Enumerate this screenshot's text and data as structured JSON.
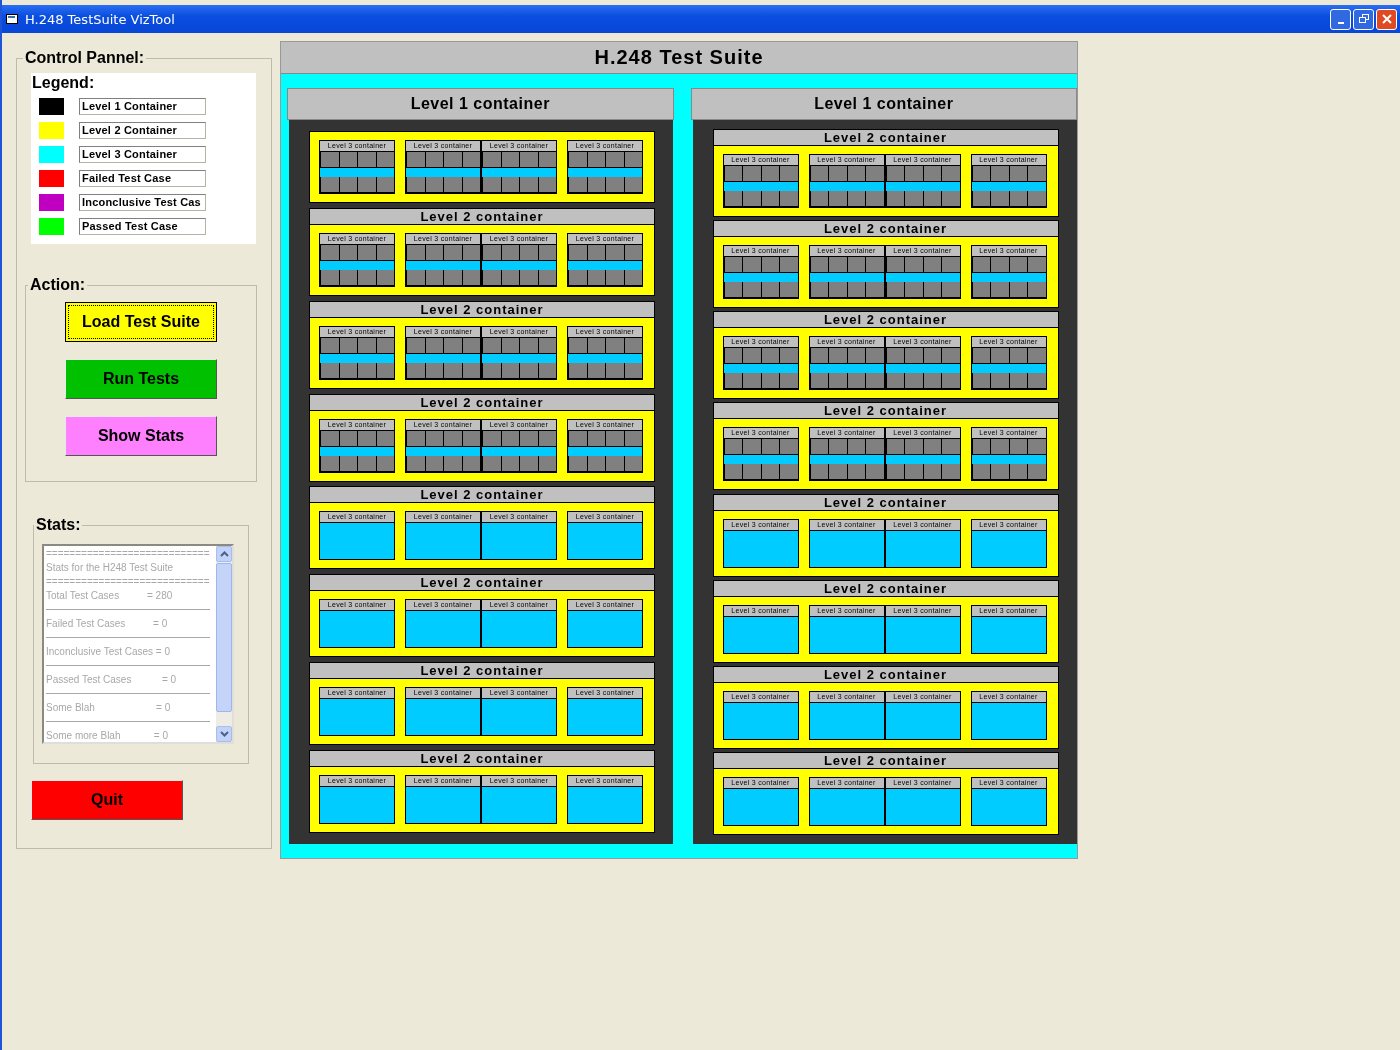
{
  "window": {
    "title": "H.248 TestSuite VizTool"
  },
  "control_panel": {
    "title": "Control Pannel:",
    "legend": {
      "title": "Legend:",
      "items": [
        {
          "label": "Level 1 Container",
          "color": "#000000"
        },
        {
          "label": "Level 2 Container",
          "color": "#ffff00"
        },
        {
          "label": "Level 3 Container",
          "color": "#00ffff"
        },
        {
          "label": "Failed Test Case",
          "color": "#ff0000"
        },
        {
          "label": "Inconclusive Test Cas",
          "color": "#c000c0"
        },
        {
          "label": "Passed Test Case",
          "color": "#00ff00"
        }
      ]
    },
    "action": {
      "title": "Action:",
      "buttons": [
        {
          "label": "Load Test Suite",
          "color": "#ffff00",
          "focused": true
        },
        {
          "label": "Run Tests",
          "color": "#00c000",
          "focused": false
        },
        {
          "label": "Show Stats",
          "color": "#ff80ff",
          "focused": false
        }
      ]
    },
    "stats": {
      "title": "Stats:",
      "lines": [
        {
          "kind": "text",
          "text": "============================"
        },
        {
          "kind": "text",
          "text": "Stats for the H248 Test Suite"
        },
        {
          "kind": "text",
          "text": "============================"
        },
        {
          "kind": "text",
          "text": "Total Test Cases          = 280"
        },
        {
          "kind": "rule"
        },
        {
          "kind": "text",
          "text": "Failed Test Cases          = 0"
        },
        {
          "kind": "rule"
        },
        {
          "kind": "text",
          "text": "Inconclusive Test Cases = 0"
        },
        {
          "kind": "rule"
        },
        {
          "kind": "text",
          "text": "Passed Test Cases           = 0"
        },
        {
          "kind": "rule"
        },
        {
          "kind": "text",
          "text": "Some Blah                      = 0"
        },
        {
          "kind": "rule"
        },
        {
          "kind": "text",
          "text": "Some more Blah            = 0"
        }
      ]
    },
    "quit": {
      "label": "Quit",
      "color": "#ff0000"
    }
  },
  "suite": {
    "title": "H.248 Test Suite",
    "level1": [
      {
        "title": "Level 1 container",
        "level2": [
          {
            "level3": [
              {
                "label": "Level 3 container",
                "kind": "grid"
              },
              {
                "label": "Level 3 container",
                "kind": "grid"
              },
              {
                "label": "Level 3 container",
                "kind": "grid"
              },
              {
                "label": "Level 3 container",
                "kind": "grid"
              }
            ]
          },
          {
            "title": "Level 2 container",
            "level3": [
              {
                "label": "Level 3 container",
                "kind": "grid"
              },
              {
                "label": "Level 3 container",
                "kind": "grid"
              },
              {
                "label": "Level 3 container",
                "kind": "grid"
              },
              {
                "label": "Level 3 container",
                "kind": "grid"
              }
            ]
          },
          {
            "title": "Level 2 container",
            "level3": [
              {
                "label": "Level 3 container",
                "kind": "grid"
              },
              {
                "label": "Level 3 container",
                "kind": "grid"
              },
              {
                "label": "Level 3 container",
                "kind": "grid"
              },
              {
                "label": "Level 3 container",
                "kind": "grid"
              }
            ]
          },
          {
            "title": "Level 2 container",
            "level3": [
              {
                "label": "Level 3 container",
                "kind": "grid"
              },
              {
                "label": "Level 3 container",
                "kind": "grid"
              },
              {
                "label": "Level 3 container",
                "kind": "grid"
              },
              {
                "label": "Level 3 container",
                "kind": "grid"
              }
            ]
          },
          {
            "title": "Level 2 container",
            "level3": [
              {
                "label": "Level 3 container",
                "kind": "empty"
              },
              {
                "label": "Level 3 container",
                "kind": "empty"
              },
              {
                "label": "Level 3 container",
                "kind": "empty"
              },
              {
                "label": "Level 3 container",
                "kind": "empty"
              }
            ]
          },
          {
            "title": "Level 2 container",
            "level3": [
              {
                "label": "Level 3 container",
                "kind": "empty"
              },
              {
                "label": "Level 3 container",
                "kind": "empty"
              },
              {
                "label": "Level 3 container",
                "kind": "empty"
              },
              {
                "label": "Level 3 container",
                "kind": "empty"
              }
            ]
          },
          {
            "title": "Level 2 container",
            "level3": [
              {
                "label": "Level 3 container",
                "kind": "empty"
              },
              {
                "label": "Level 3 container",
                "kind": "empty"
              },
              {
                "label": "Level 3 container",
                "kind": "empty"
              },
              {
                "label": "Level 3 container",
                "kind": "empty"
              }
            ]
          },
          {
            "title": "Level 2 container",
            "level3": [
              {
                "label": "Level 3 container",
                "kind": "empty"
              },
              {
                "label": "Level 3 container",
                "kind": "empty"
              },
              {
                "label": "Level 3 container",
                "kind": "empty"
              },
              {
                "label": "Level 3 container",
                "kind": "empty"
              }
            ]
          }
        ]
      },
      {
        "title": "Level 1 container",
        "level2": [
          {
            "title": "Level 2 container",
            "level3": [
              {
                "label": "Level 3 container",
                "kind": "grid"
              },
              {
                "label": "Level 3 container",
                "kind": "grid"
              },
              {
                "label": "Level 3 container",
                "kind": "grid"
              },
              {
                "label": "Level 3 container",
                "kind": "grid"
              }
            ]
          },
          {
            "title": "Level 2 container",
            "level3": [
              {
                "label": "Level 3 container",
                "kind": "grid"
              },
              {
                "label": "Level 3 container",
                "kind": "grid"
              },
              {
                "label": "Level 3 container",
                "kind": "grid"
              },
              {
                "label": "Level 3 container",
                "kind": "grid"
              }
            ]
          },
          {
            "title": "Level 2 container",
            "level3": [
              {
                "label": "Level 3 container",
                "kind": "grid"
              },
              {
                "label": "Level 3 container",
                "kind": "grid"
              },
              {
                "label": "Level 3 container",
                "kind": "grid"
              },
              {
                "label": "Level 3 container",
                "kind": "grid"
              }
            ]
          },
          {
            "title": "Level 2 container",
            "level3": [
              {
                "label": "Level 3 container",
                "kind": "grid"
              },
              {
                "label": "Level 3 container",
                "kind": "grid"
              },
              {
                "label": "Level 3 container",
                "kind": "grid"
              },
              {
                "label": "Level 3 container",
                "kind": "grid"
              }
            ]
          },
          {
            "title": "Level 2 container",
            "level3": [
              {
                "label": "Level 3 container",
                "kind": "empty"
              },
              {
                "label": "Level 3 container",
                "kind": "empty"
              },
              {
                "label": "Level 3 container",
                "kind": "empty"
              },
              {
                "label": "Level 3 container",
                "kind": "empty"
              }
            ]
          },
          {
            "title": "Level 2 container",
            "level3": [
              {
                "label": "Level 3 container",
                "kind": "empty"
              },
              {
                "label": "Level 3 container",
                "kind": "empty"
              },
              {
                "label": "Level 3 container",
                "kind": "empty"
              },
              {
                "label": "Level 3 container",
                "kind": "empty"
              }
            ]
          },
          {
            "title": "Level 2 container",
            "level3": [
              {
                "label": "Level 3 container",
                "kind": "empty"
              },
              {
                "label": "Level 3 container",
                "kind": "empty"
              },
              {
                "label": "Level 3 container",
                "kind": "empty"
              },
              {
                "label": "Level 3 container",
                "kind": "empty"
              }
            ]
          },
          {
            "title": "Level 2 container",
            "level3": [
              {
                "label": "Level 3 container",
                "kind": "empty"
              },
              {
                "label": "Level 3 container",
                "kind": "empty"
              },
              {
                "label": "Level 3 container",
                "kind": "empty"
              },
              {
                "label": "Level 3 container",
                "kind": "empty"
              }
            ]
          }
        ]
      }
    ]
  }
}
